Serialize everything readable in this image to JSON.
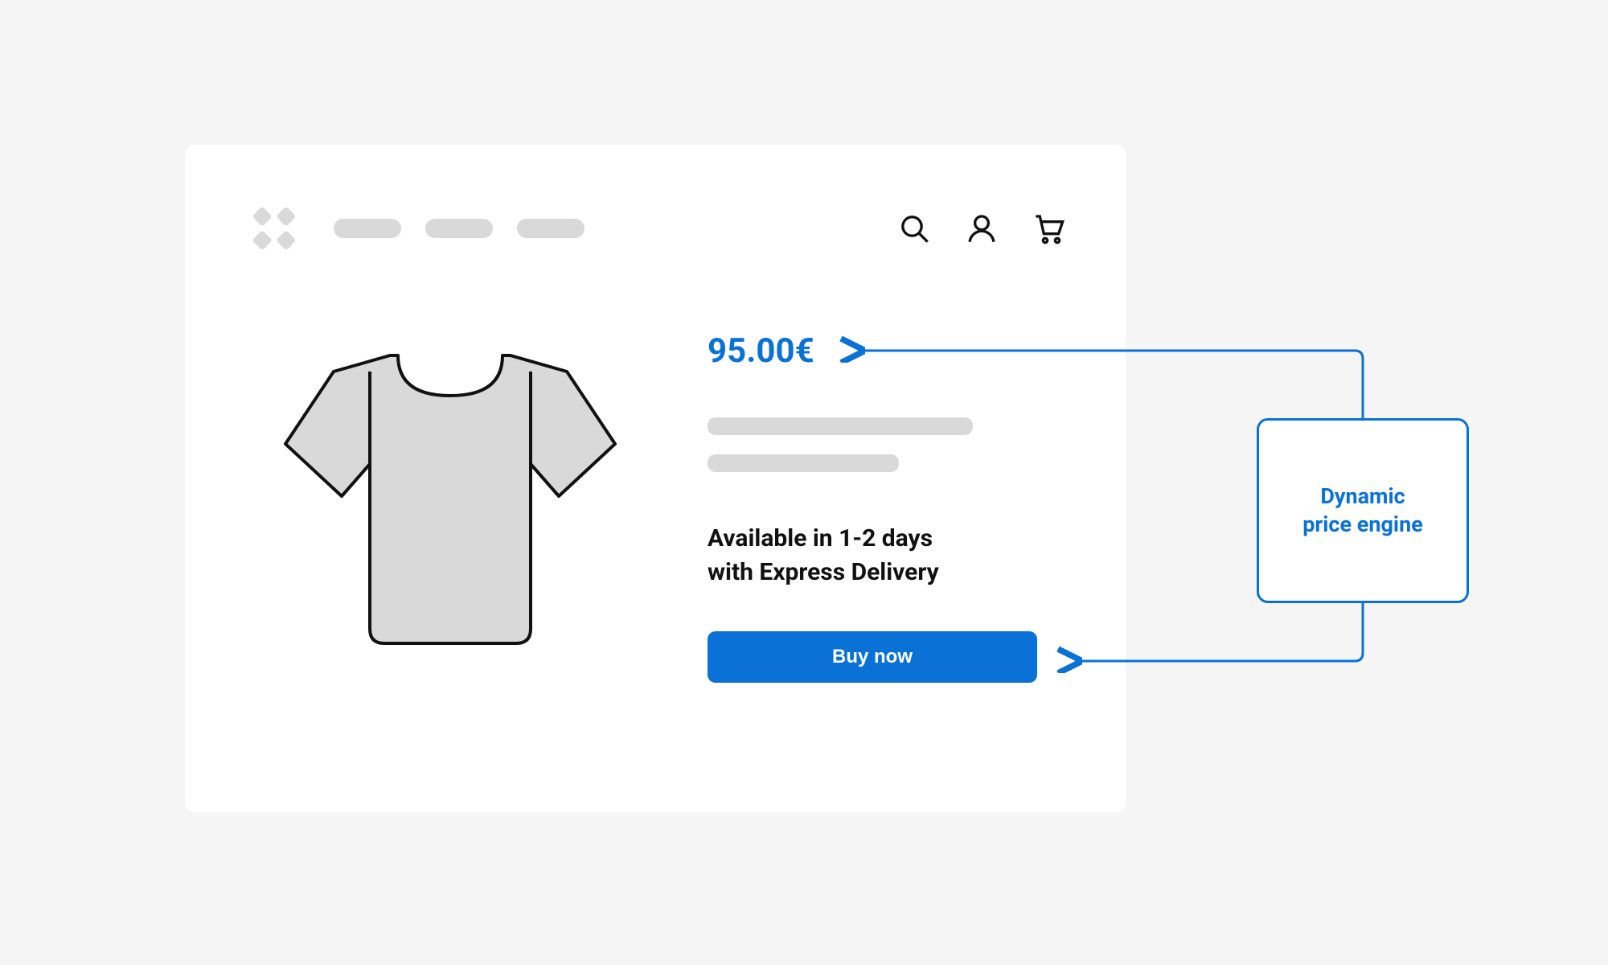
{
  "product": {
    "price": "95.00€",
    "availability": "Available in 1-2 days\nwith Express Delivery",
    "buy_label": "Buy now"
  },
  "engine": {
    "label": "Dynamic\nprice engine"
  },
  "colors": {
    "accent": "#0a72d6",
    "muted": "#d9d9d9"
  }
}
